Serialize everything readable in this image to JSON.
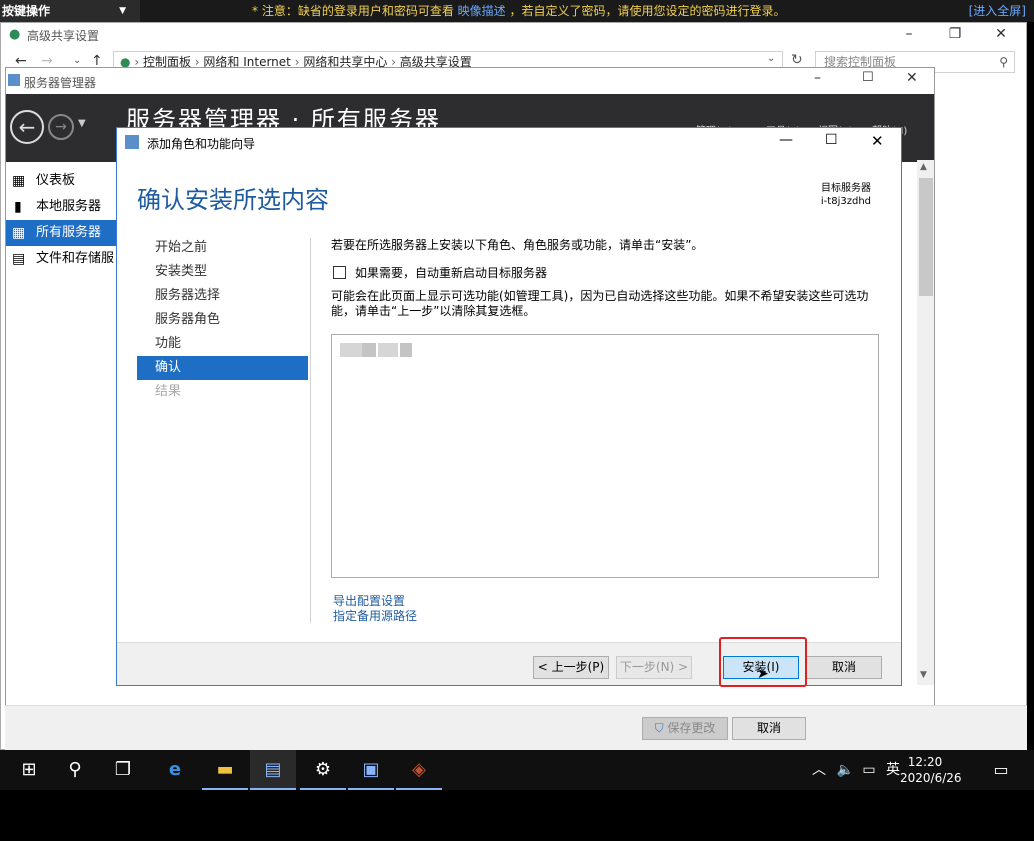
{
  "topbar": {
    "hotkeys": "按键操作",
    "notice_prefix": "* 注意：缺省的登录用户和密码可查看",
    "notice_link": "映像描述",
    "notice_suffix": "，若自定义了密码，请使用您设定的密码进行登录。",
    "enter_fullscreen": "[进入全屏]"
  },
  "explorer": {
    "title": "高级共享设置",
    "path": [
      "控制面板",
      "网络和 Internet",
      "网络和共享中心",
      "高级共享设置"
    ],
    "search_placeholder": "搜索控制面板",
    "save_label": "保存更改",
    "cancel_label": "取消"
  },
  "server_manager": {
    "title": "服务器管理器",
    "header": "服务器管理器 · 所有服务器",
    "nav": [
      {
        "label": "仪表板"
      },
      {
        "label": "本地服务器"
      },
      {
        "label": "所有服务器"
      },
      {
        "label": "文件和存储服"
      }
    ],
    "menus": [
      "管理(M)",
      "工具(T)",
      "视图(V)",
      "帮助(H)"
    ]
  },
  "wizard": {
    "title": "添加角色和功能向导",
    "heading": "确认安装所选内容",
    "target_label": "目标服务器",
    "target_value": "i-t8j3zdhd",
    "steps": [
      {
        "label": "开始之前",
        "state": "normal"
      },
      {
        "label": "安装类型",
        "state": "normal"
      },
      {
        "label": "服务器选择",
        "state": "normal"
      },
      {
        "label": "服务器角色",
        "state": "normal"
      },
      {
        "label": "功能",
        "state": "normal"
      },
      {
        "label": "确认",
        "state": "selected"
      },
      {
        "label": "结果",
        "state": "disabled"
      }
    ],
    "intro": "若要在所选服务器上安装以下角色、角色服务或功能，请单击“安装”。",
    "restart_checkbox": "如果需要，自动重新启动目标服务器",
    "restart_checked": false,
    "optional_note": "可能会在此页面上显示可选功能(如管理工具)，因为已自动选择这些功能。如果不希望安装这些可选功能，请单击“上一步”以清除其复选框。",
    "export_link": "导出配置设置",
    "alt_source_link": "指定备用源路径",
    "buttons": {
      "prev": "< 上一步(P)",
      "next": "下一步(N) >",
      "install": "安装(I)",
      "cancel": "取消"
    }
  },
  "taskbar": {
    "time": "12:20",
    "date": "2020/6/26",
    "ime": "英"
  },
  "colors": {
    "accent": "#1f6ec6",
    "heading": "#1f5b9f",
    "highlight": "#e02020",
    "notice": "#f0d050"
  }
}
